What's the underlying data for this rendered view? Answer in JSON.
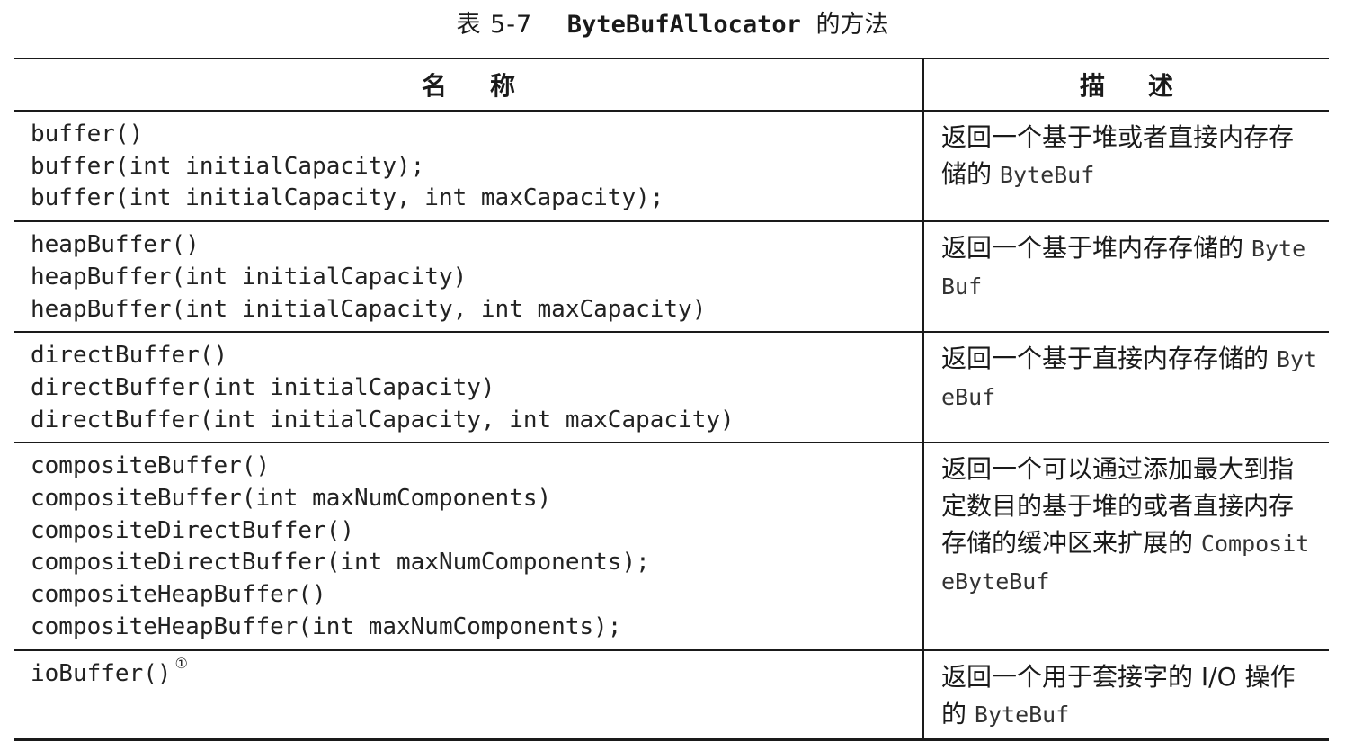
{
  "caption": {
    "label": "表 5-7",
    "class_name": "ByteBufAllocator",
    "suffix": "的方法"
  },
  "headers": {
    "name": "名称",
    "description": "描述"
  },
  "rows": [
    {
      "methods": [
        "buffer()",
        "buffer(int initialCapacity);",
        "buffer(int initialCapacity, int maxCapacity);"
      ],
      "description_text": "返回一个基于堆或者直接内存存储的",
      "description_code": "ByteBuf"
    },
    {
      "methods": [
        "heapBuffer()",
        "heapBuffer(int initialCapacity)",
        "heapBuffer(int initialCapacity, int maxCapacity)"
      ],
      "description_text": "返回一个基于堆内存存储的",
      "description_code": "ByteBuf"
    },
    {
      "methods": [
        "directBuffer()",
        "directBuffer(int initialCapacity)",
        "directBuffer(int initialCapacity, int maxCapacity)"
      ],
      "description_text": "返回一个基于直接内存存储的",
      "description_code": "ByteBuf"
    },
    {
      "methods": [
        "compositeBuffer()",
        "compositeBuffer(int maxNumComponents)",
        "compositeDirectBuffer()",
        "compositeDirectBuffer(int maxNumComponents);",
        "compositeHeapBuffer()",
        "compositeHeapBuffer(int maxNumComponents);"
      ],
      "description_text": "返回一个可以通过添加最大到指定数目的基于堆的或者直接内存存储的缓冲区来扩展的",
      "description_code": "CompositeByteBuf"
    },
    {
      "methods": [
        "ioBuffer()"
      ],
      "footnote": "①",
      "description_text": "返回一个用于套接字的 I/O 操作的",
      "description_code": "ByteBuf"
    }
  ]
}
